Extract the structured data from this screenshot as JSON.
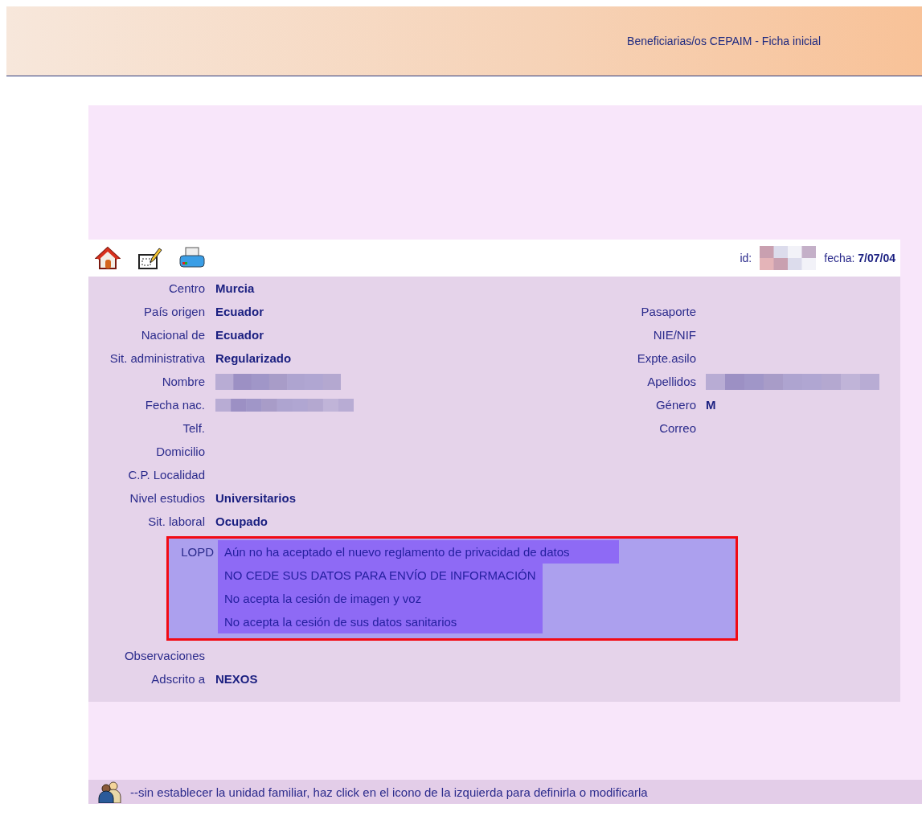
{
  "header": {
    "title": "Beneficiarias/os CEPAIM - Ficha inicial"
  },
  "record": {
    "id_label": "id:",
    "id_redacted": true,
    "date_label": "fecha:",
    "date": "7/07/04"
  },
  "rows": [
    {
      "kind": "pair",
      "left": {
        "label": "Centro",
        "value": "Murcia"
      }
    },
    {
      "kind": "pair",
      "left": {
        "label": "País origen",
        "value": "Ecuador"
      },
      "right": {
        "label": "Pasaporte"
      }
    },
    {
      "kind": "pair",
      "left": {
        "label": "Nacional de",
        "value": "Ecuador"
      },
      "right": {
        "label": "NIE/NIF"
      }
    },
    {
      "kind": "pair",
      "left": {
        "label": "Sit. administrativa",
        "value": "Regularizado"
      },
      "right": {
        "label": "Expte.asilo"
      }
    },
    {
      "kind": "pair",
      "left": {
        "label": "Nombre",
        "redacted": true
      },
      "right": {
        "label": "Apellidos",
        "redacted": true
      }
    },
    {
      "kind": "pair",
      "left": {
        "label": "Fecha nac.",
        "redacted": true
      },
      "right": {
        "label": "Género",
        "value": "M"
      }
    },
    {
      "kind": "pair",
      "left": {
        "label": "Telf."
      },
      "right": {
        "label": "Correo"
      }
    },
    {
      "kind": "pair",
      "left": {
        "label": "Domicilio"
      }
    },
    {
      "kind": "pair",
      "left": {
        "label": "C.P. Localidad"
      }
    },
    {
      "kind": "pair",
      "left": {
        "label": "Nivel estudios",
        "value": "Universitarios"
      }
    },
    {
      "kind": "pair",
      "left": {
        "label": "Sit. laboral",
        "value": "Ocupado"
      }
    },
    {
      "kind": "lopd",
      "label": "LOPD",
      "items": [
        "Aún no ha aceptado el nuevo reglamento de privacidad de datos",
        "NO CEDE SUS DATOS PARA ENVÍO DE INFORMACIÓN",
        "No acepta la cesión de imagen y voz",
        "No acepta la cesión de sus datos sanitarios"
      ]
    },
    {
      "kind": "pair",
      "left": {
        "label": "Observaciones"
      }
    },
    {
      "kind": "pair",
      "left": {
        "label": "Adscrito a",
        "value": "NEXOS"
      }
    }
  ],
  "footer": {
    "text": "--sin establecer la unidad familiar, haz click en el icono de la izquierda para definirla o modificarla"
  }
}
